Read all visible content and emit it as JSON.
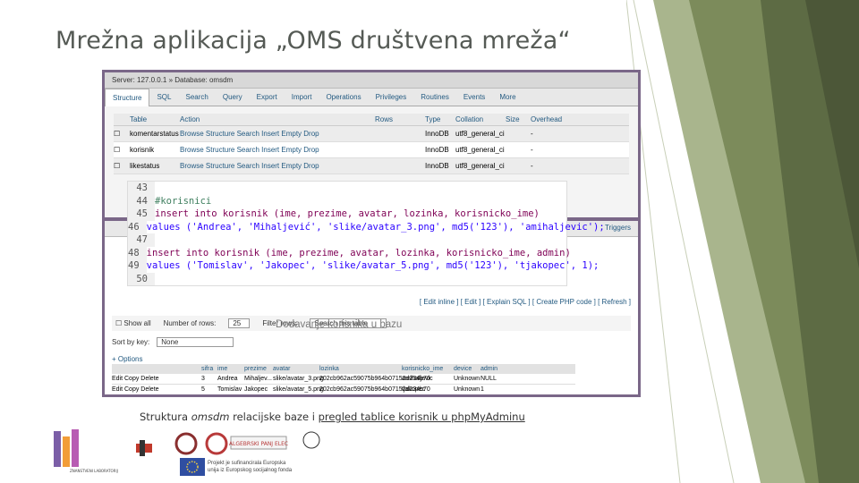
{
  "slide": {
    "title": "Mrežna aplikacija „OMS društvena mreža“",
    "caption_pre": "Struktura ",
    "caption_em": "omsdm",
    "caption_mid": " relacijske baze i ",
    "caption_link": "pregled tablice korisnik u phpMyAdminu",
    "watermark": "Dodavanje korisnika u bazu"
  },
  "pma_top": {
    "breadcrumb": "Server: 127.0.0.1 » Database: omsdm",
    "tabs": [
      "Structure",
      "SQL",
      "Search",
      "Query",
      "Export",
      "Import",
      "Operations",
      "Privileges",
      "Routines",
      "Events",
      "More"
    ],
    "headers": [
      "Table",
      "Action",
      "Rows",
      "Type",
      "Collation",
      "Size",
      "Overhead"
    ],
    "rows": [
      {
        "name": "komentarstatus",
        "actions": "Browse Structure Search Insert Empty Drop",
        "rows": "",
        "type": "InnoDB",
        "collation": "utf8_general_ci",
        "size": "",
        "overhead": "-"
      },
      {
        "name": "korisnik",
        "actions": "Browse Structure Search Insert Empty Drop",
        "rows": "",
        "type": "InnoDB",
        "collation": "utf8_general_ci",
        "size": "",
        "overhead": "-"
      },
      {
        "name": "likestatus",
        "actions": "Browse Structure Search Insert Empty Drop",
        "rows": "",
        "type": "InnoDB",
        "collation": "utf8_general_ci",
        "size": "",
        "overhead": "-"
      }
    ]
  },
  "code": {
    "lines": [
      {
        "n": "43",
        "text": ""
      },
      {
        "n": "44",
        "text": "#korisnici"
      },
      {
        "n": "45",
        "text": "insert into korisnik (ime, prezime, avatar, lozinka, korisnicko_ime)"
      },
      {
        "n": "46",
        "text": "values ('Andrea', 'Mihaljević', 'slike/avatar_3.png', md5('123'), 'amihaljevic');"
      },
      {
        "n": "47",
        "text": ""
      },
      {
        "n": "48",
        "text": "insert into korisnik (ime, prezime, avatar, lozinka, korisnicko_ime, admin)"
      },
      {
        "n": "49",
        "text": "values ('Tomislav', 'Jakopec', 'slike/avatar_5.png', md5('123'), 'tjakopec', 1);"
      },
      {
        "n": "50",
        "text": ""
      }
    ]
  },
  "pma_bottom": {
    "tab_right": "Triggers",
    "toolbar": "[ Edit inline ] [ Edit ] [ Explain SQL ] [ Create PHP code ] [ Refresh ]",
    "show_all": "Show all",
    "rows_label": "Number of rows:",
    "rows_value": "25",
    "filter_label": "Filter rows:",
    "filter_placeholder": "Search this table",
    "sort_label": "Sort by key:",
    "sort_value": "None",
    "options": "+ Options",
    "grid_headers": [
      "",
      "sifra",
      "ime",
      "prezime",
      "avatar",
      "lozinka",
      "korisnicko_ime",
      "device",
      "admin"
    ],
    "grid_rows": [
      {
        "actions": "Edit  Copy  Delete",
        "sifra": "3",
        "ime": "Andrea",
        "prezime": "Mihaljev...",
        "avatar": "slike/avatar_3.png",
        "lozinka": "202cb962ac59075b964b07152d234b70",
        "korisnicko_ime": "amihaljevic",
        "device": "Unknown",
        "admin": "NULL"
      },
      {
        "actions": "Edit  Copy  Delete",
        "sifra": "5",
        "ime": "Tomislav",
        "prezime": "Jakopec",
        "avatar": "slike/avatar_5.png",
        "lozinka": "202cb962ac59075b964b07152d234b70",
        "korisnicko_ime": "tjakopec",
        "device": "Unknown",
        "admin": "1"
      }
    ]
  },
  "footer": {
    "eu_text_1": "Projekt je sufinancirala Europska",
    "eu_text_2": "unija iz Europskog socijalnog fonda",
    "lab_text": "ZNANSTVENI LABORATORIJ",
    "partner_text": "ALGEBRSKI PANJ ELEC"
  },
  "colors": {
    "frame": "#7a6788",
    "deco_dark": "#5d6b44",
    "deco_light": "#98a878",
    "link": "#235a81"
  }
}
